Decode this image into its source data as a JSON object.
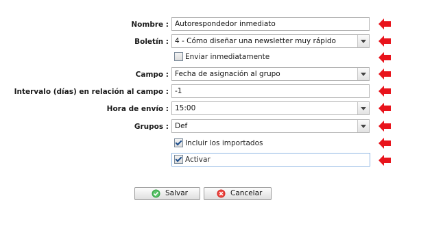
{
  "form": {
    "nombre": {
      "label": "Nombre :",
      "value": "Autorespondedor inmediato"
    },
    "boletin": {
      "label": "Boletín :",
      "value": "4 - Cómo diseñar una newsletter muy rápido"
    },
    "enviar": {
      "label": "Enviar inmediatamente",
      "checked": false
    },
    "campo": {
      "label": "Campo :",
      "value": "Fecha de asignación al grupo"
    },
    "intervalo": {
      "label": "Intervalo (días) en relación al campo :",
      "value": "-1"
    },
    "hora": {
      "label": "Hora de envío :",
      "value": "15:00"
    },
    "grupos": {
      "label": "Grupos :",
      "value": "Def"
    },
    "incluir": {
      "label": "Incluir los importados",
      "checked": true
    },
    "activar": {
      "label": "Activar",
      "checked": true
    }
  },
  "buttons": {
    "save": "Salvar",
    "cancel": "Cancelar"
  },
  "colors": {
    "arrow": "#e8141c",
    "save_icon": "#3aa84a",
    "cancel_icon": "#d9302c"
  }
}
